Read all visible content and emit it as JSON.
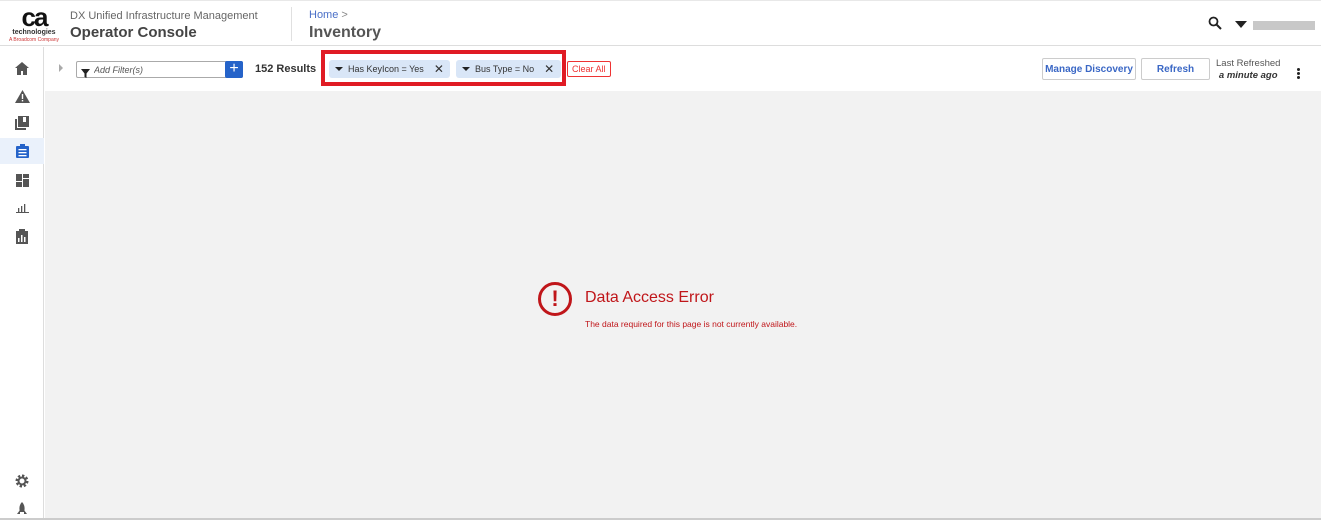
{
  "header": {
    "logo": {
      "mark": "ca",
      "line1": "technologies",
      "line2": "A Broadcom Company"
    },
    "product_sub": "DX Unified Infrastructure Management",
    "product_name": "Operator Console",
    "breadcrumb_home": "Home",
    "breadcrumb_sep": ">",
    "page_title": "Inventory"
  },
  "sidebar": {
    "items": [
      {
        "icon": "home-icon"
      },
      {
        "icon": "alarm-icon"
      },
      {
        "icon": "library-icon"
      },
      {
        "icon": "inventory-icon",
        "active": true
      },
      {
        "icon": "dashboard-icon"
      },
      {
        "icon": "reports-icon"
      },
      {
        "icon": "metrics-icon"
      }
    ],
    "bottom": [
      {
        "icon": "gear-icon"
      },
      {
        "icon": "rocket-icon"
      }
    ]
  },
  "toolbar": {
    "filter_placeholder": "Add Filter(s)",
    "add_label": "+",
    "results": "152 Results",
    "chips": [
      {
        "label": "Has KeyIcon = Yes",
        "close": "✕"
      },
      {
        "label": "Bus Type = No",
        "close": "✕"
      }
    ],
    "clear_all": "Clear All",
    "manage_discovery": "Manage Discovery",
    "refresh": "Refresh",
    "last_refreshed_label": "Last Refreshed",
    "last_refreshed_value": "a minute ago"
  },
  "error": {
    "icon": "!",
    "title": "Data Access Error",
    "message": "The data required for this page is not currently available."
  },
  "colors": {
    "accent": "#2563c9",
    "error": "#c0161a",
    "highlight": "#e01b24",
    "chip": "#d9e6f7"
  }
}
